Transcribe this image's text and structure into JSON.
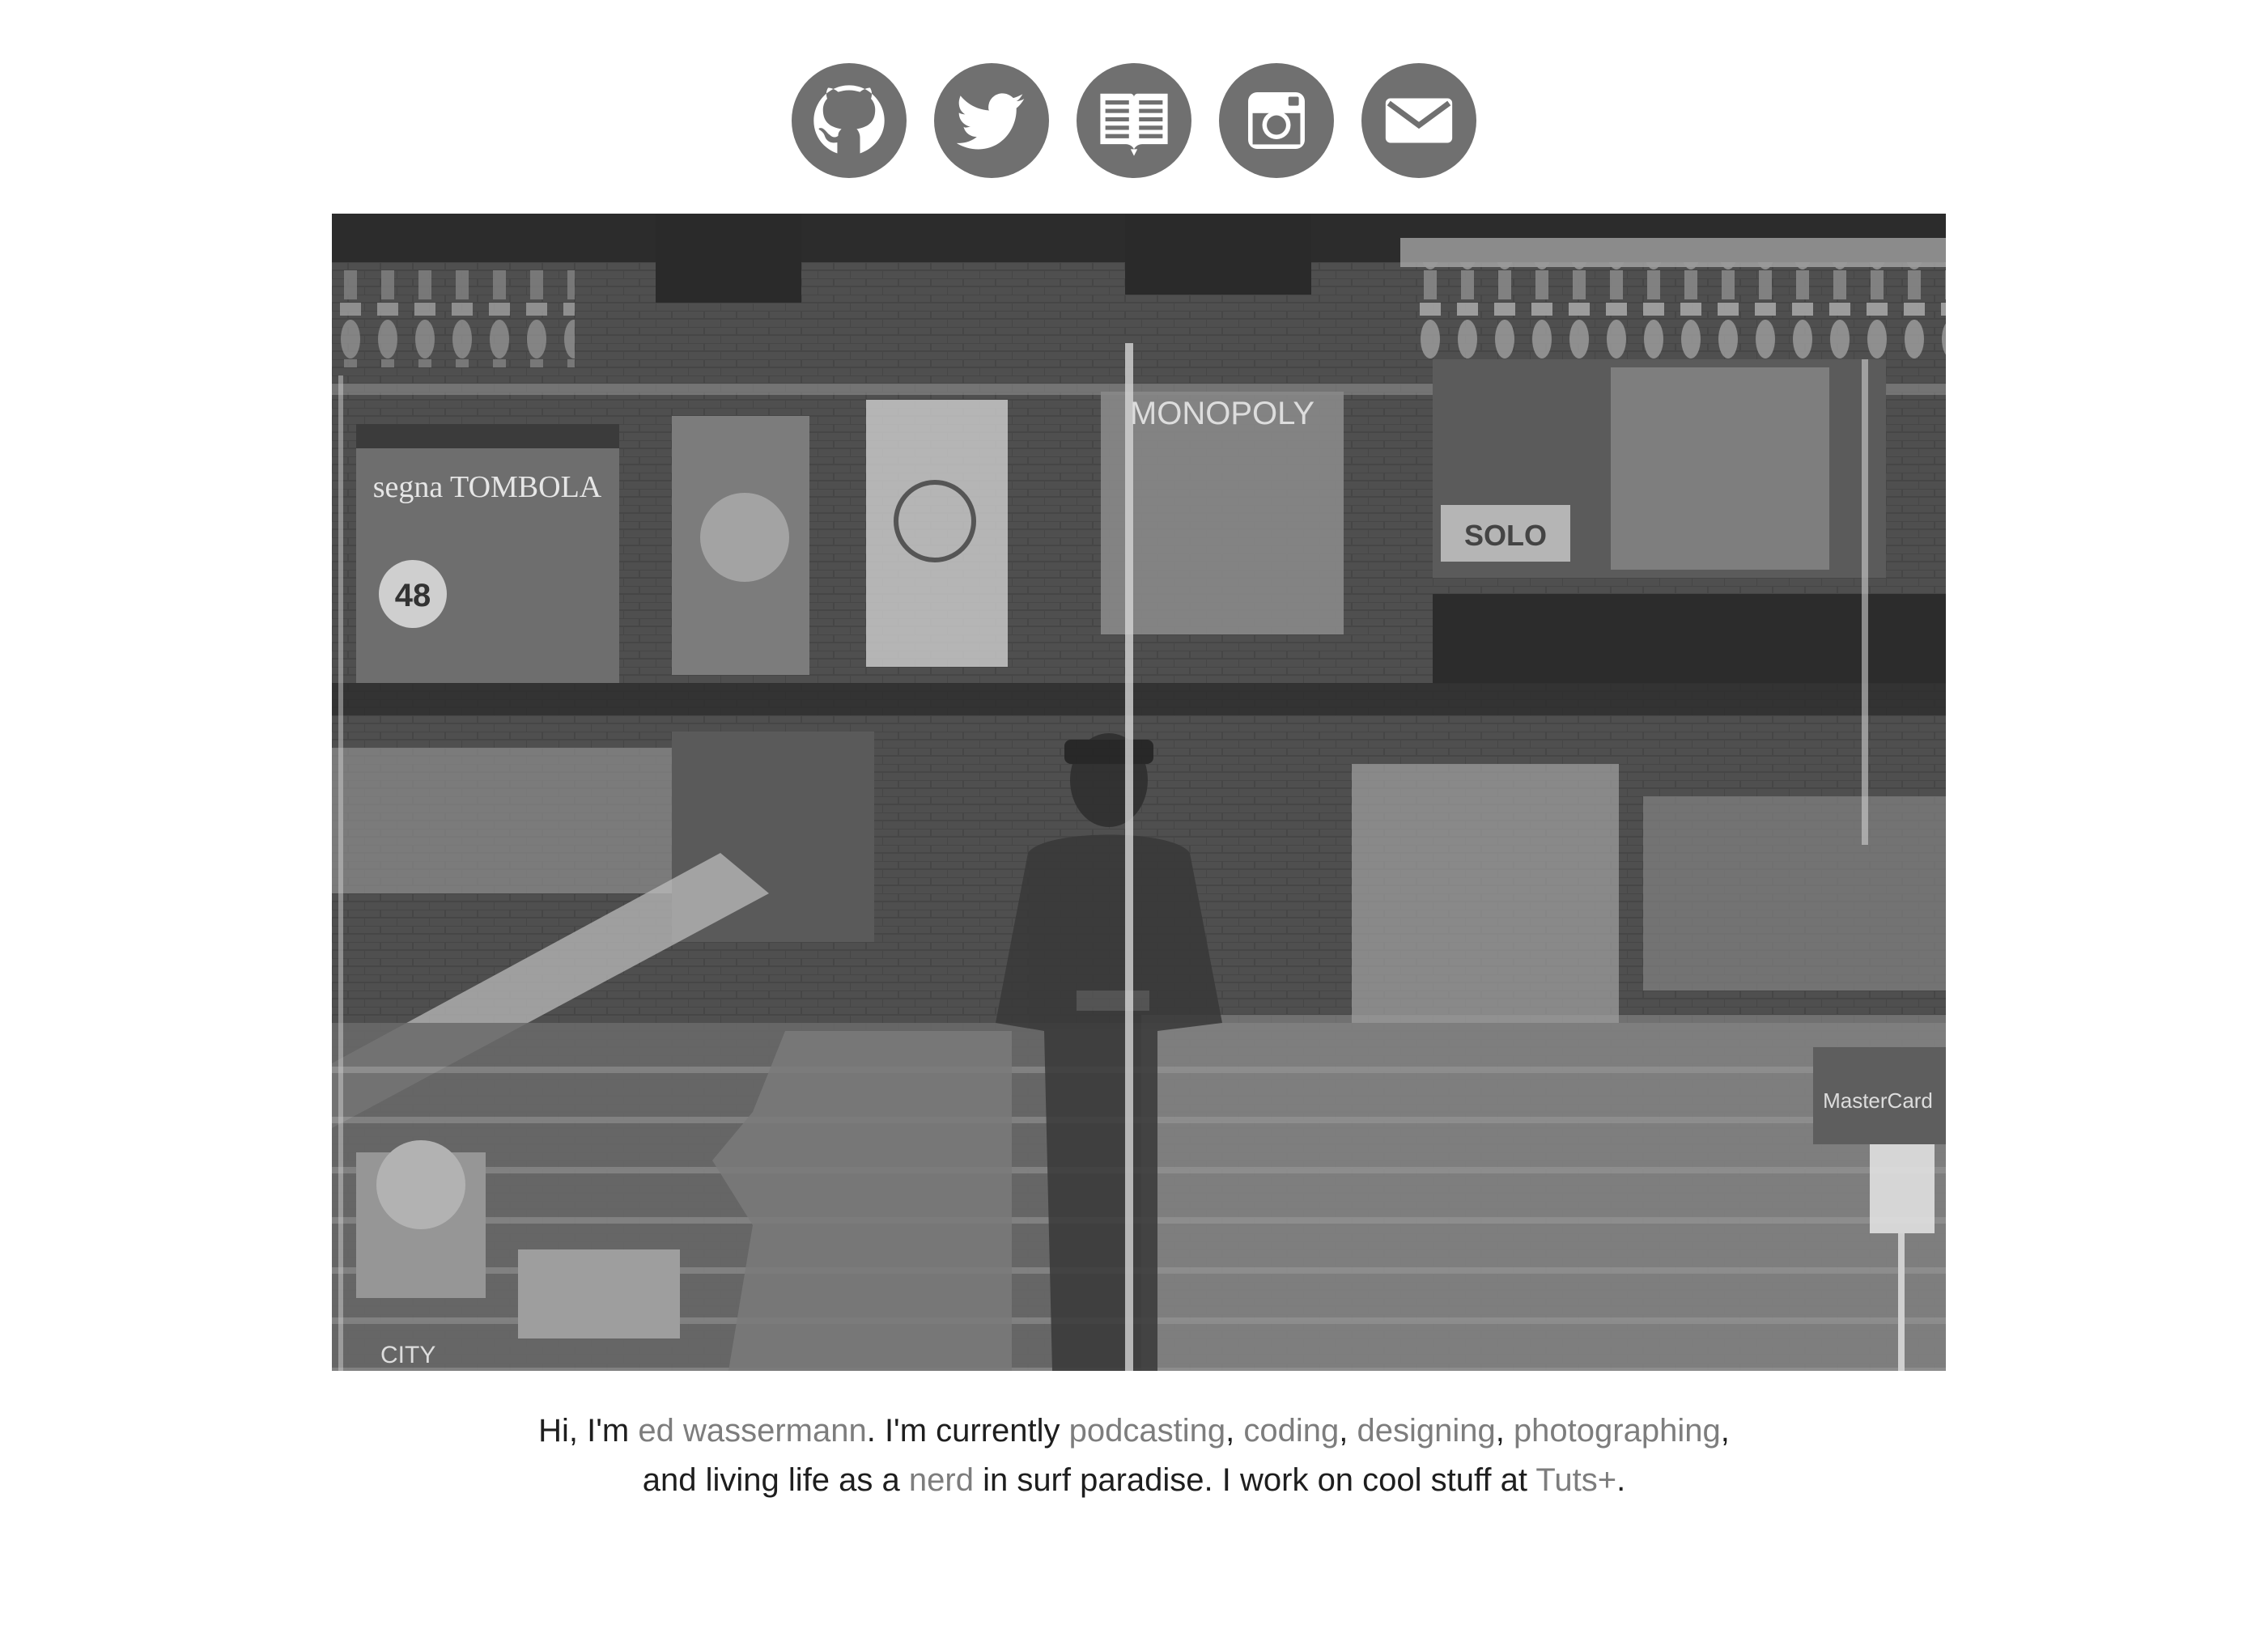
{
  "social": {
    "items": [
      {
        "name": "github",
        "icon": "github-icon"
      },
      {
        "name": "twitter",
        "icon": "twitter-icon"
      },
      {
        "name": "blog",
        "icon": "open-book-icon"
      },
      {
        "name": "instagram",
        "icon": "instagram-icon"
      },
      {
        "name": "email",
        "icon": "envelope-icon"
      }
    ],
    "color": "#707070"
  },
  "photo": {
    "style": "black-and-white double-exposure",
    "sign_texts": [
      "segna TOMBOLA",
      "48",
      "MONOPOLY",
      "SOLO",
      "MasterCard",
      "CITY"
    ]
  },
  "bio": {
    "t1": "Hi, I'm ",
    "name": "ed wassermann",
    "t2": ". I'm currently ",
    "podcasting": "podcasting",
    "sep1": ", ",
    "coding": "coding",
    "sep2": ", ",
    "designing": "designing",
    "sep3": ", ",
    "photographing": "photographing",
    "t3": ", and living life as a ",
    "nerd": "nerd",
    "t4": " in surf paradise. I work on cool stuff at ",
    "tuts": "Tuts+",
    "t5": "."
  },
  "colors": {
    "link": "#7d7d7d",
    "text": "#1e1e1e",
    "icon_circle": "#707070",
    "background": "#ffffff"
  }
}
